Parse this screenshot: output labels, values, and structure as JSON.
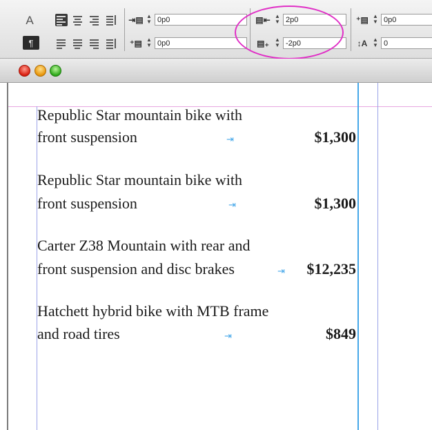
{
  "toolbar": {
    "char_mode_label": "A",
    "para_mode_label": "¶",
    "left_indent_value": "0p0",
    "first_line_indent_value": "0p0",
    "right_indent_value": "2p0",
    "last_line_indent_value": "-2p0",
    "space_before_value": "0p0",
    "drop_cap_lines_value": "0",
    "highlight_color": "#e02fc6"
  },
  "window": {
    "buttons": [
      "close",
      "minimize",
      "zoom"
    ]
  },
  "document": {
    "items": [
      {
        "line1": "Republic Star mountain bike with",
        "line2": "front suspension",
        "price": "$1,300"
      },
      {
        "line1": "Republic Star mountain bike with",
        "line2": "front suspension",
        "price": "$1,300"
      },
      {
        "line1": "Carter Z38 Mountain with rear and",
        "line2": "front suspension and disc brakes",
        "price": "$12,235"
      },
      {
        "line1": "Hatchett hybrid bike with MTB frame",
        "line2": "and road tires",
        "price": "$849"
      }
    ],
    "tab_marker_glyph": "⇥",
    "guide_color": "#45a7e9",
    "margin_color": "#e7a6e0"
  }
}
